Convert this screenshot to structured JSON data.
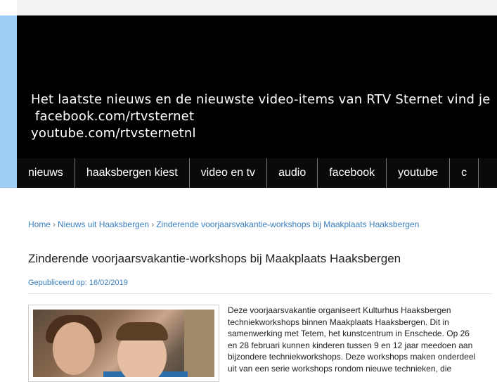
{
  "header": {
    "lines": [
      "Het laatste nieuws en de nieuwste video-items van RTV Sternet vind je",
      " facebook.com/rtvsternet",
      "youtube.com/rtvsternetnl"
    ]
  },
  "nav": {
    "items": [
      "nieuws",
      "haaksbergen kiest",
      "video en tv",
      "audio",
      "facebook",
      "youtube",
      "c"
    ]
  },
  "breadcrumb": {
    "home": "Home",
    "sep": "›",
    "section": "Nieuws uit Haaksbergen",
    "current": "Zinderende voorjaarsvakantie-workshops bij Maakplaats Haaksbergen"
  },
  "article": {
    "title": "Zinderende voorjaarsvakantie-workshops bij Maakplaats Haaksbergen",
    "published": "Gepubliceerd op: 16/02/2019",
    "body_lines": [
      "Deze voorjaarsvakantie organiseert Kulturhus Haaksbergen",
      "techniekworkshops binnen Maakplaats Haaksbergen. Dit in",
      "samenwerking met Tetem, het kunstcentrum in Enschede. Op 26",
      "en 28 februari kunnen kinderen tussen 9 en 12 jaar meedoen aan",
      "bijzondere techniekworkshops. Deze workshops maken onderdeel",
      "uit van een serie workshops rondom nieuwe technieken, die"
    ]
  }
}
